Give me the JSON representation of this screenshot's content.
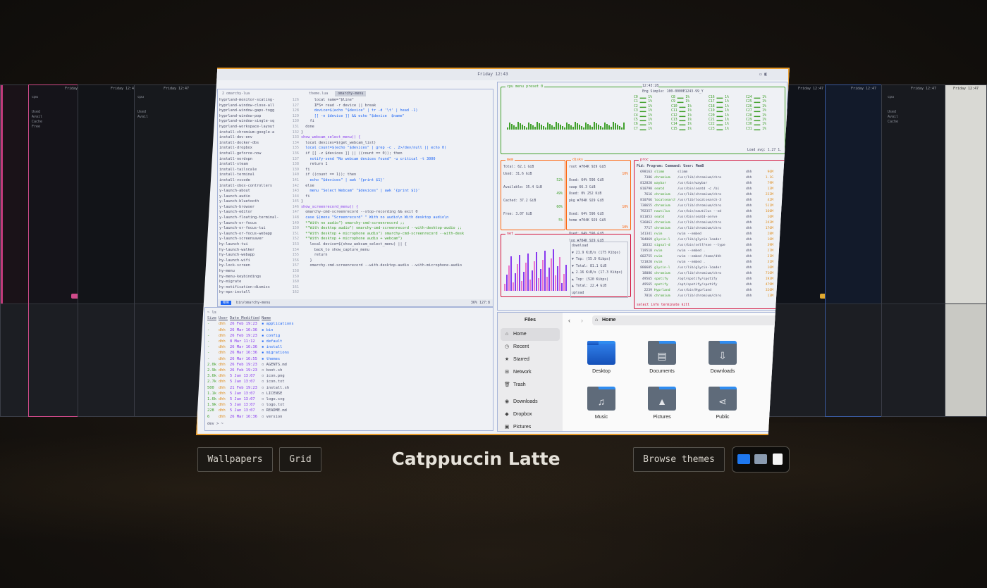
{
  "colors": {
    "selection_border": "#e69a2a",
    "accent_blue": "#1e66f5",
    "bg": "#1a1510"
  },
  "preview": {
    "clock": "Friday 12:43",
    "side_cards_clock": "Friday 12:47",
    "editor": {
      "tabs": [
        "2 omarchy-lua",
        "theme.lua",
        "omarchy-menu"
      ],
      "tree": [
        "hyprland-monitor-scaling-",
        "hyprland-window-close-all",
        "hyprland-window-gaps-togg",
        "hyprland-window-pop",
        "hyprland-window-single-sq",
        "hyprland-workspace-layout",
        "install-chromium-google-a",
        "install-dev-env",
        "install-docker-dbs",
        "install-dropbox",
        "install-geforce-now",
        "install-nordvpn",
        "install-steam",
        "install-tailscale",
        "install-terminal",
        "install-vscode",
        "install-xbox-controllers",
        "y-launch-about",
        "y-launch-audio",
        "y-launch-bluetooth",
        "y-launch-browser",
        "y-launch-editor",
        "y-launch-floating-terminal-",
        "y-launch-or-focus",
        "y-launch-or-focus-tui",
        "y-launch-or-focus-webapp",
        "y-launch-screensaver",
        "hy-launch-tui",
        "hy-launch-walker",
        "hy-launch-webapp",
        "hy-launch-wifi",
        "hy-lock-screen",
        "hy-menu",
        "hy-menu-keybindings",
        "hy-migrate",
        "hy-notification-dismiss",
        "hy-npx-install"
      ],
      "line_numbers": [
        "126",
        "127",
        "128",
        "129",
        "130",
        "131",
        "132",
        "133",
        "134",
        "135",
        "136",
        "137",
        "138",
        "139",
        "140",
        "141",
        "142",
        "143",
        "144",
        "145",
        "146",
        "147",
        "148",
        "149",
        "150",
        "151",
        "152",
        "153",
        "154",
        "155",
        "156",
        "157",
        "158",
        "159",
        "160",
        "161",
        "162"
      ],
      "code": [
        "      local name=\"$line\"",
        "      IFS= read -r device || break",
        "      device=$(echo \"$device\" | tr -d '\\t' | head -1)",
        "      [[ -n $device ]] && echo \"$device  $name\"",
        "    fi",
        "  done",
        "}",
        "",
        "show_webcam_select_menu() {",
        "  local devices=$(get_webcam_list)",
        "  local count=$(echo \"$devices\" | grep -c . 2>/dev/null || echo 0)",
        "",
        "  if [[ -z $devices ]] || ((count == 0)); then",
        "    notify-send \"No webcam devices found\" -u critical -t 3000",
        "    return 1",
        "  fi",
        "",
        "  if ((count == 1)); then",
        "    echo \"$devices\" | awk '{print $1}'",
        "  else",
        "    menu \"Select Webcam\" \"$devices\" | awk '{print $1}'",
        "  fi",
        "}",
        "",
        "show_screenrecord_menu() {",
        "  omarchy-cmd-screenrecord --stop-recording && exit 0",
        "",
        "  case $(menu \"Screenrecord\" \" With no audio\\n With desktop audio\\n",
        "  *\"With no audio\") omarchy-cmd-screenrecord ;;",
        "  *\"With desktop audio\") omarchy-cmd-screenrecord --with-desktop-audio ;;",
        "  *\"With desktop + microphone audio\") omarchy-cmd-screenrecord --with-desk",
        "  *\"With desktop + microphone audio + webcam\")",
        "    local device=$(show_webcam_select_menu) || {",
        "      back_to show_capture_menu",
        "      return",
        "    }",
        "    omarchy-cmd-screenrecord --with-desktop-audio --with-microphone-audio"
      ],
      "status_mode": "NOR",
      "status_path": "bin/omarchy-menu",
      "status_right": "36%  127:8"
    },
    "listing": {
      "prompt": "~ ls",
      "headers": [
        "Size",
        "User",
        "Date Modified",
        "Name"
      ],
      "rows": [
        [
          "-",
          "dhh",
          "26 Feb 19:23",
          "applications",
          "dir"
        ],
        [
          "-",
          "dhh",
          "26 Mar 16:36",
          "bin",
          "dir"
        ],
        [
          "-",
          "dhh",
          "26 Feb 19:23",
          "config",
          "dir"
        ],
        [
          "-",
          "dhh",
          " 8 Mar 11:12",
          "default",
          "dir"
        ],
        [
          "-",
          "dhh",
          "26 Mar 16:36",
          "install",
          "dir"
        ],
        [
          "-",
          "dhh",
          "26 Mar 16:36",
          "migrations",
          "dir"
        ],
        [
          "-",
          "dhh",
          "26 Mar 16:55",
          "themes",
          "dir"
        ],
        [
          "2.0k",
          "dhh",
          "26 Feb 19:23",
          "AGENTS.md",
          "file"
        ],
        [
          "2.9k",
          "dhh",
          "26 Feb 19:23",
          "boot.sh",
          "file"
        ],
        [
          "3.6k",
          "dhh",
          " 5 Jan 13:07",
          "icon.png",
          "file"
        ],
        [
          "2.7k",
          "dhh",
          " 5 Jan 13:07",
          "icon.txt",
          "file"
        ],
        [
          "500",
          "dhh",
          "21 Feb 19:23",
          "install.sh",
          "file"
        ],
        [
          "1.1k",
          "dhh",
          " 5 Jan 13:07",
          "LICENSE",
          "file"
        ],
        [
          "1.6k",
          "dhh",
          " 5 Jan 13:07",
          "logo.svg",
          "file"
        ],
        [
          "1.9k",
          "dhh",
          " 5 Jan 13:07",
          "logo.txt",
          "file"
        ],
        [
          "228",
          "dhh",
          " 5 Jan 13:07",
          "README.md",
          "file"
        ],
        [
          "6",
          "dhh",
          "26 Mar 16:36",
          "version",
          "file"
        ]
      ],
      "status": "dev > ~"
    },
    "btop": {
      "header": "cpu  menu  preset 0",
      "clock": "12:43:28",
      "cpu_title": "Eng Simple: 100-0000E1243-99_Y",
      "load": "Load avg: 1.27 1.",
      "mem": {
        "title": "mem",
        "lines": [
          "Total:           62.1 GiB",
          "Used:            31.6 GiB",
          "52%",
          "Available:       35.4 GiB",
          "49%",
          "Cached:          37.2 GiB",
          "60%",
          "Free:            3.07 GiB",
          "5%"
        ]
      },
      "disks": {
        "title": "disks",
        "lines": [
          "root     ▼704K    929 GiB",
          "10%",
          "Used: 64%        596 GiB",
          "swap              66.3 GiB",
          "Used:  0%        252 KiB",
          "pkg      ▼704K    929 GiB",
          "10%",
          "Used: 64%        596 GiB",
          "home     ▼704K    929 GiB",
          "10%",
          "Used: 64%        596 GiB",
          "log      ▼704K    929 GiB"
        ]
      },
      "net": {
        "title": "net",
        "lines": [
          "download",
          "▼ 21.9 KiB/s  (175 Kibps)",
          "▼ Top:        (55.9 Kibps)",
          "▼ Total:       81.1 GiB",
          "▲ 2.16 KiB/s  (17.3 Kibps)",
          "▲ Top:        (520 Kibps)",
          "▲ Total:       22.4 GiB",
          "upload"
        ]
      },
      "proc": {
        "title": "proc",
        "header": "Pid: Program:  Command:              User:  MemB",
        "rows": [
          [
            "698163",
            "slimm",
            "slimm",
            "dhh",
            "96M"
          ],
          [
            "7386",
            "chromium",
            "/usr/lib/chromium/chro",
            "dhh",
            "1.1G"
          ],
          [
            "812820",
            "waybar",
            "/usr/bin/waybar",
            "dhh",
            "79M"
          ],
          [
            "810798",
            "seatd",
            "/usr/bin/seatd -c /bi",
            "dhh",
            "13M"
          ],
          [
            "7616",
            "chromium",
            "/usr/lib/chromium/chro",
            "dhh",
            "232M"
          ],
          [
            "810766",
            "localsearch",
            "/usr/lib/localsearch-3",
            "dhh",
            "42M"
          ],
          [
            "738655",
            "chromium",
            "/usr/lib/chromium/chro",
            "dhh",
            "511M"
          ],
          [
            "792357",
            "nautilus",
            "/usr/bin/nautilus --nd",
            "dhh",
            "160M"
          ],
          [
            "811053",
            "seatd",
            "/usr/bin/seatd-serve",
            "dhh",
            "16M"
          ],
          [
            "536863",
            "chromium",
            "/usr/lib/chromium/chro",
            "dhh",
            "243M"
          ],
          [
            "7717",
            "chromium",
            "/usr/lib/chromium/chro",
            "dhh",
            "176M"
          ],
          [
            "141341",
            "nvim",
            "nvim --embed",
            "dhh",
            "28M"
          ],
          [
            "704869",
            "glycin-l",
            "/usr/lib/glycin-loader",
            "dhh",
            "16M"
          ],
          [
            "18332",
            "signal-d",
            "/usr/bin/self/exe --type",
            "dhh",
            "39M"
          ],
          [
            "719518",
            "nvim",
            "nvim --embed .",
            "dhh",
            "27M"
          ],
          [
            "602755",
            "nvim",
            "nvim --embed /home/dhh",
            "dhh",
            "31M"
          ],
          [
            "721820",
            "nvim",
            "nvim --embed .",
            "dhh",
            "31M"
          ],
          [
            "880605",
            "glycin-l",
            "/usr/lib/glycin-loader",
            "dhh",
            "16M"
          ],
          [
            "18086",
            "chromium",
            "/usr/lib/chromium/chro",
            "dhh",
            "716M"
          ],
          [
            "49565",
            "spotify",
            "/opt/spotify/spotify",
            "dhh",
            "193M"
          ],
          [
            "49565",
            "spotify",
            "/opt/spotify/spotify",
            "dhh",
            "479M"
          ],
          [
            "2239",
            "Hyprland",
            "/usr/bin/Hyprland",
            "dhh",
            "326M"
          ],
          [
            "7816",
            "chromium",
            "/usr/lib/chromium/chro",
            "dhh",
            "13M"
          ]
        ],
        "footer": "select  info  terminate  kill"
      }
    },
    "files": {
      "title": "Files",
      "path": "Home",
      "sidebar": [
        {
          "label": "Home",
          "icon": "home-icon",
          "glyph": "⌂",
          "selected": true
        },
        {
          "label": "Recent",
          "icon": "clock-icon",
          "glyph": "◷",
          "selected": false
        },
        {
          "label": "Starred",
          "icon": "star-icon",
          "glyph": "★",
          "selected": false
        },
        {
          "label": "Network",
          "icon": "network-icon",
          "glyph": "⊞",
          "selected": false
        },
        {
          "label": "Trash",
          "icon": "trash-icon",
          "glyph": "🗑",
          "selected": false
        },
        {
          "label": "Downloads",
          "icon": "download-icon",
          "glyph": "◉",
          "selected": false
        },
        {
          "label": "Dropbox",
          "icon": "dropbox-icon",
          "glyph": "◆",
          "selected": false
        },
        {
          "label": "Pictures",
          "icon": "pictures-icon",
          "glyph": "▣",
          "selected": false
        }
      ],
      "folders": [
        {
          "label": "Desktop",
          "icon": "desktop-folder-icon",
          "glyph": ""
        },
        {
          "label": "Documents",
          "icon": "documents-folder-icon",
          "glyph": "▤"
        },
        {
          "label": "Downloads",
          "icon": "downloads-folder-icon",
          "glyph": "⇩"
        },
        {
          "label": "Music",
          "icon": "music-folder-icon",
          "glyph": "♫"
        },
        {
          "label": "Pictures",
          "icon": "pictures-folder-icon",
          "glyph": "▲"
        },
        {
          "label": "Public",
          "icon": "public-folder-icon",
          "glyph": "⋖"
        }
      ]
    }
  },
  "controls": {
    "wallpapers": "Wallpapers",
    "grid": "Grid",
    "theme_name": "Catppuccin Latte",
    "browse_themes": "Browse themes",
    "icon_set": [
      "blue-folder-icon",
      "gray-folder-icon",
      "white-document-icon"
    ]
  }
}
